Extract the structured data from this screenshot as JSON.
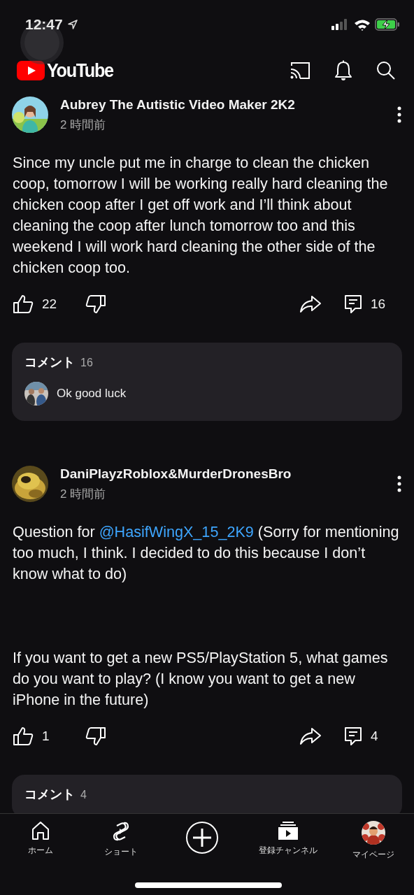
{
  "status_bar": {
    "time": "12:47"
  },
  "header": {
    "logo": "YouTube"
  },
  "posts": [
    {
      "author": "Aubrey The Autistic Video Maker 2K2",
      "time": "2 時間前",
      "paragraphs": [
        [
          {
            "kind": "text",
            "text": "Since my uncle put me in charge to clean the chicken coop, tomorrow I will be working really hard cleaning the chicken coop after I get off work and I’ll think about cleaning the coop after lunch tomorrow too and this weekend I will work hard cleaning the other side of the chicken coop too."
          }
        ]
      ],
      "likes": "22",
      "comments": "16",
      "comment_section": {
        "title": "コメント",
        "count": "16",
        "preview": "Ok good luck"
      }
    },
    {
      "author": "DaniPlayzRoblox&MurderDronesBro",
      "time": "2 時間前",
      "paragraphs": [
        [
          {
            "kind": "text",
            "text": "Question for "
          },
          {
            "kind": "mention",
            "text": "@HasifWingX_15_2K9"
          },
          {
            "kind": "text",
            "text": " (Sorry for mentioning too much, I think. I decided to do this because I don’t know what to do)"
          }
        ],
        [
          {
            "kind": "text",
            "text": "If you want to get a new PS5/PlayStation 5, what games do you want to play? (I know you want to get a new iPhone in the future)"
          }
        ]
      ],
      "likes": "1",
      "comments": "4",
      "comment_section": {
        "title": "コメント",
        "count": "4"
      }
    }
  ],
  "nav": [
    {
      "label": "ホーム",
      "kind": "home",
      "selected": false
    },
    {
      "label": "ショート",
      "kind": "shorts",
      "selected": false
    },
    {
      "kind": "create"
    },
    {
      "label": "登録チャンネル",
      "kind": "subscriptions",
      "selected": false
    },
    {
      "label": "マイページ",
      "kind": "profile",
      "selected": false
    }
  ]
}
